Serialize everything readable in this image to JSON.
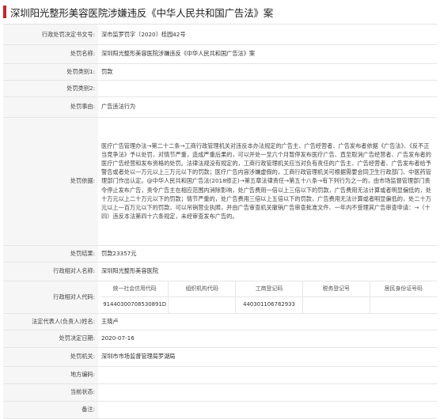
{
  "title": "深圳阳光整形美容医院涉嫌违反《中华人民共和国广告法》案",
  "rows": [
    {
      "label": "行政处罚决定书文号:",
      "value": "深市监罗罚字〔2020〕桂园42号"
    },
    {
      "label": "处罚名称:",
      "value": "深圳阳光整形美容医院涉嫌违反《中华人民共和国广告法》案"
    },
    {
      "label": "处罚类别1:",
      "value": "罚款"
    },
    {
      "label": "处罚类别2:",
      "value": ""
    },
    {
      "label": "处罚事由:",
      "value": "广告违法行为"
    },
    {
      "label": "处罚依据:",
      "value": "医疗广告管理办法→第二十二条→工商行政管理机关对违反本办法规定的广告主、广告经营者、广告发布者依据《广告法》、《反不正当竞争法》予以处罚，对情节严重，造成严重后果的，可以并处一至六个月暂停发布医疗广告、直至取消广告经营者、广告发布者的医疗广告经营和发布资格的处罚。法律法规没有规定的，工商行政管理机关应当对负有责任的广告主、广告经营者、广告发布者给予警告或者处以一万元以上三万元以下的罚款；医疗广告内容涉嫌虚假的，工商行政管理机关可根据需要会同卫生行政部门、中医药管理部门作出认定。@中华人民共和国广告法(2018修正)→第五章法律责任→第五十八条→有下列行为之一的，由市场监督管理部门责令停止发布广告，责令广告主在相应范围内消除影响，处广告费用一倍以上三倍以下的罚款，广告费用无法计算或者明显偏低的，处十万元以上二十万元以下的罚款；情节严重的，处广告费用三倍以上五倍以下的罚款，广告费用无法计算或者明显偏低的，处二十万元以上一百万元以下的罚款，可以吊销营业执照，并由广告审查机关撤销广告审查批准文件、一年内不受理其广告审查申请：→（十四）违反本法第四十六条规定，未经审查发布广告的。"
    },
    {
      "label": "处罚结果:",
      "value": "罚款23357元"
    },
    {
      "label": "行政相对人名称:",
      "value": "深圳阳光整形美容医院"
    }
  ],
  "codes": {
    "label": "行政相对人代码:",
    "headers": [
      "统一社会信用代码",
      "组织机构代码",
      "工商登记码",
      "税务登记号",
      "居民身份证号码"
    ],
    "values": [
      "91440300708530891D",
      "",
      "440301106782933",
      "",
      ""
    ]
  },
  "rows2": [
    {
      "label": "法定代表人(负责人)姓名:",
      "value": "王晓卢"
    },
    {
      "label": "处罚决定日期:",
      "value": "2020-07-16"
    },
    {
      "label": "处罚机关:",
      "value": "深圳市市场监督管理局罗湖局"
    },
    {
      "label": "地方编码:",
      "value": ""
    },
    {
      "label": "当前状态:",
      "value": ""
    },
    {
      "label": "备注:",
      "value": ""
    }
  ]
}
